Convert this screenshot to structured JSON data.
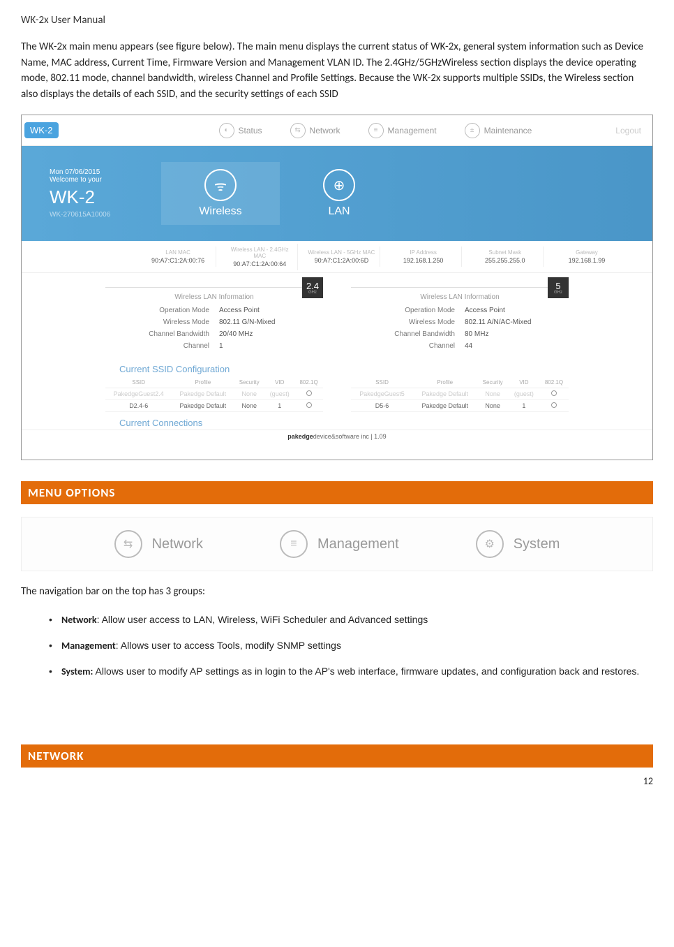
{
  "header": "WK-2x User Manual",
  "intro": "The WK-2x main menu appears (see figure below). The main menu displays the current status of WK-2x, general system information such as Device Name, MAC address, Current Time, Firmware Version and Management VLAN ID.  The 2.4GHz/5GHzWireless section displays the device operating mode, 802.11 mode, channel bandwidth, wireless Channel and Profile Settings. Because the WK-2x supports multiple SSIDs, the Wireless section also displays the details of each SSID, and the security settings of each SSID",
  "shot1": {
    "badge": "WK-2",
    "tabs": {
      "status": "Status",
      "network": "Network",
      "management": "Management",
      "maintenance": "Maintenance"
    },
    "logout": "Logout",
    "hero": {
      "date": "Mon 07/06/2015",
      "welcome": "Welcome to your",
      "device": "WK-2",
      "serial": "WK-270615A10006",
      "wireless": "Wireless",
      "lan": "LAN"
    },
    "mac": {
      "lan_lbl": "LAN MAC",
      "lan": "90:A7:C1:2A:00:76",
      "w24_lbl": "Wireless LAN - 2.4GHz MAC",
      "w24": "90:A7:C1:2A:00:64",
      "w5_lbl": "Wireless LAN - 5GHz MAC",
      "w5": "90:A7:C1:2A:00:6D",
      "ip_lbl": "IP Address",
      "ip": "192.168.1.250",
      "mask_lbl": "Subnet Mask",
      "mask": "255.255.255.0",
      "gw_lbl": "Gateway",
      "gw": "192.168.1.99"
    },
    "wlan_title": "Wireless LAN Information",
    "wlan24": {
      "ghz": "2.4",
      "sub": "GHz",
      "op_l": "Operation Mode",
      "op": "Access Point",
      "wm_l": "Wireless Mode",
      "wm": "802.11 G/N-Mixed",
      "cb_l": "Channel Bandwidth",
      "cb": "20/40 MHz",
      "ch_l": "Channel",
      "ch": "1"
    },
    "wlan5": {
      "ghz": "5",
      "sub": "GHz",
      "op_l": "Operation Mode",
      "op": "Access Point",
      "wm_l": "Wireless Mode",
      "wm": "802.11 A/N/AC-Mixed",
      "cb_l": "Channel Bandwidth",
      "cb": "80 MHz",
      "ch_l": "Channel",
      "ch": "44"
    },
    "ssid_title": "Current SSID Configuration",
    "ssid_cols": {
      "ssid": "SSID",
      "profile": "Profile",
      "security": "Security",
      "vid": "VID",
      "q": "802.1Q"
    },
    "ssid24": [
      {
        "ssid": "PakedgeGuest2.4",
        "profile": "Pakedge Default",
        "security": "None",
        "vid": "(guest)",
        "dim": true
      },
      {
        "ssid": "D2.4-6",
        "profile": "Pakedge Default",
        "security": "None",
        "vid": "1",
        "dim": false
      }
    ],
    "ssid5": [
      {
        "ssid": "PakedgeGuest5",
        "profile": "Pakedge Default",
        "security": "None",
        "vid": "(guest)",
        "dim": true
      },
      {
        "ssid": "D5-6",
        "profile": "Pakedge Default",
        "security": "None",
        "vid": "1",
        "dim": false
      }
    ],
    "conn_title": "Current Connections",
    "footer_bold": "pakedge",
    "footer_rest": "device&software inc | 1.09"
  },
  "section1": "MENU OPTIONS",
  "shot2": {
    "network": "Network",
    "management": "Management",
    "system": "System"
  },
  "nav_intro": "The navigation bar on the top has 3 groups:",
  "bullets": {
    "b1_lead": "Network",
    "b1_rest": ": Allow user access to LAN, Wireless, WiFi Scheduler and Advanced settings",
    "b2_lead": "Management",
    "b2_rest": ": Allows user to access Tools, modify SNMP settings",
    "b3_lead": "System:",
    "b3_rest": " Allows user to modify AP settings as in login to the AP's web interface, firmware updates, and configuration back and restores."
  },
  "section2": "NETWORK",
  "pagenum": "12"
}
